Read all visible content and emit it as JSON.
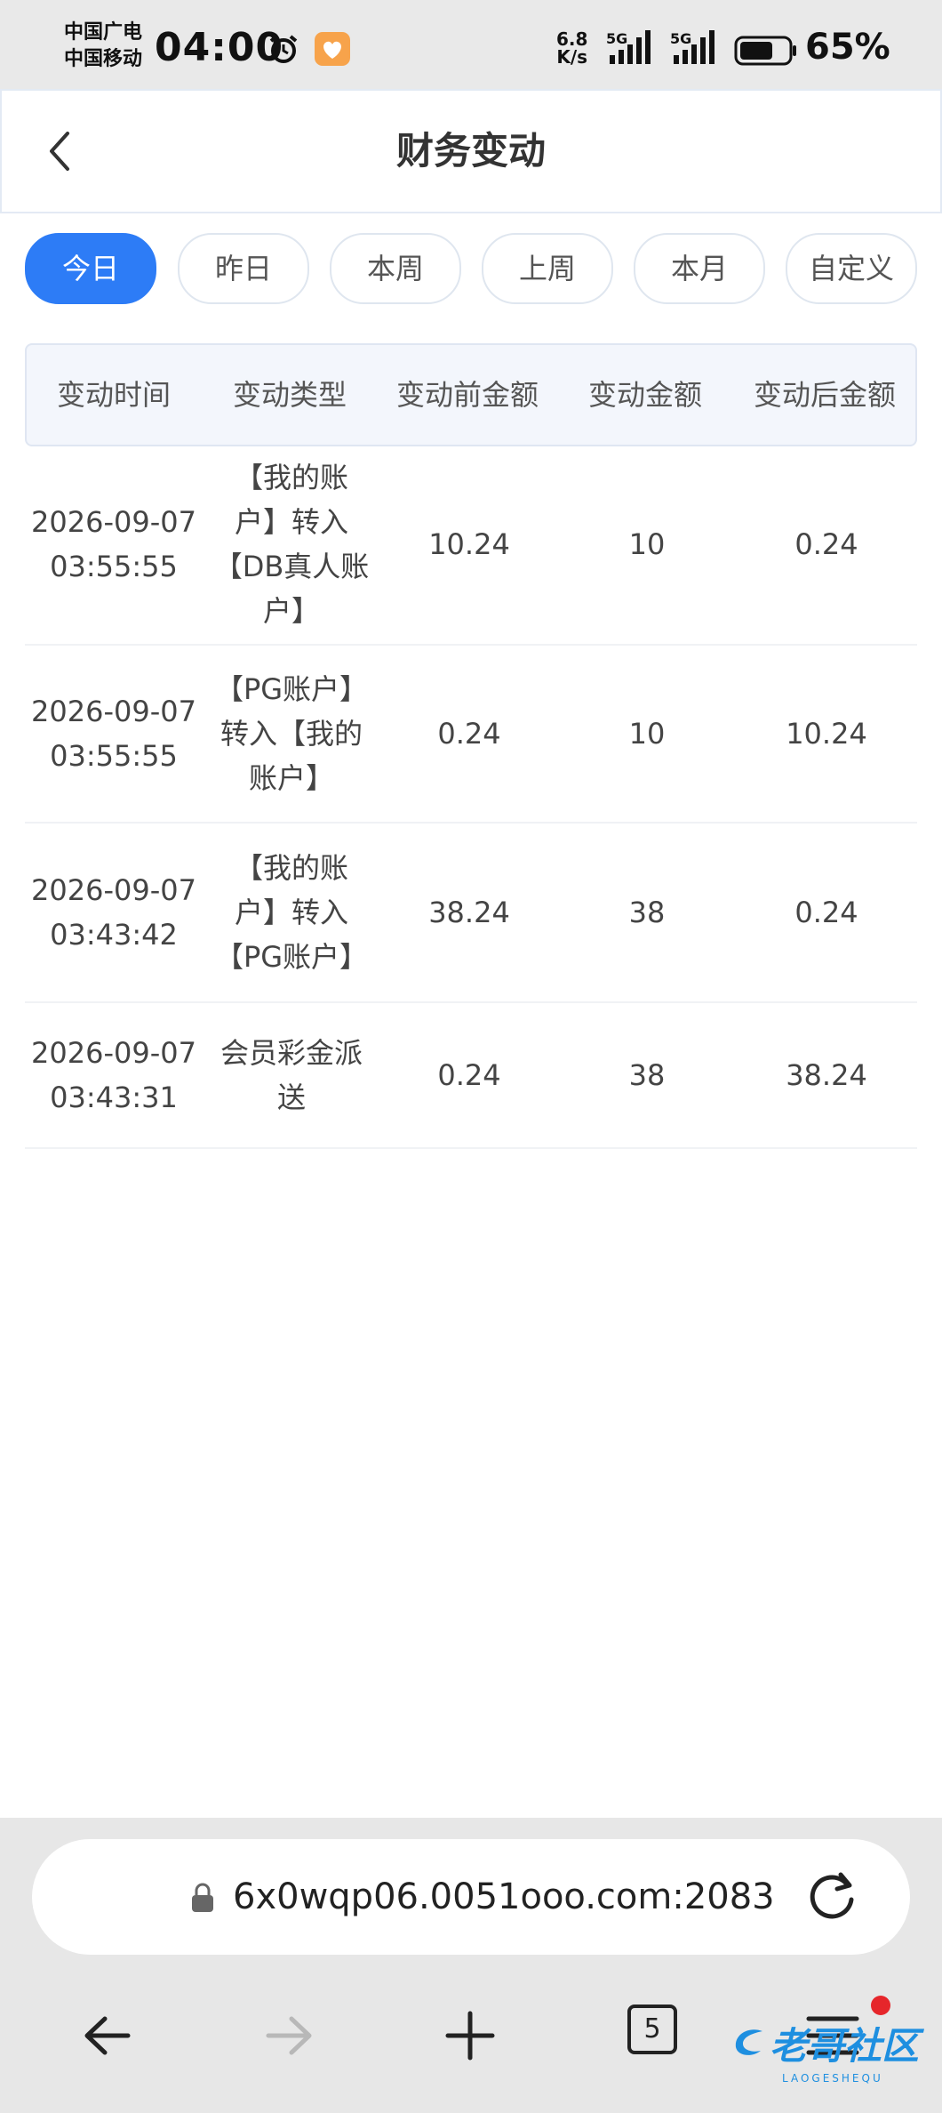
{
  "status_bar": {
    "carrier_1": "中国广电",
    "carrier_2": "中国移动",
    "time": "04:00",
    "net_speed_value": "6.8",
    "net_speed_unit": "K/s",
    "signal_1": "5G",
    "signal_2": "5G",
    "battery": "65%"
  },
  "header": {
    "title": "财务变动"
  },
  "filters": [
    {
      "label": "今日",
      "active": true
    },
    {
      "label": "昨日",
      "active": false
    },
    {
      "label": "本周",
      "active": false
    },
    {
      "label": "上周",
      "active": false
    },
    {
      "label": "本月",
      "active": false
    },
    {
      "label": "自定义",
      "active": false
    }
  ],
  "table": {
    "columns": [
      "变动时间",
      "变动类型",
      "变动前金额",
      "变动金额",
      "变动后金额"
    ],
    "rows": [
      {
        "date": "2026-09-07",
        "time": "03:55:55",
        "type_lines": [
          "【我的账",
          "户】转入",
          "【DB真人账",
          "户】"
        ],
        "before": "10.24",
        "amount": "10",
        "after": "0.24"
      },
      {
        "date": "2026-09-07",
        "time": "03:55:55",
        "type_lines": [
          "【PG账户】",
          "转入【我的",
          "账户】"
        ],
        "before": "0.24",
        "amount": "10",
        "after": "10.24"
      },
      {
        "date": "2026-09-07",
        "time": "03:43:42",
        "type_lines": [
          "【我的账",
          "户】转入",
          "【PG账户】"
        ],
        "before": "38.24",
        "amount": "38",
        "after": "0.24"
      },
      {
        "date": "2026-09-07",
        "time": "03:43:31",
        "type_lines": [
          "会员彩金派",
          "送"
        ],
        "before": "0.24",
        "amount": "38",
        "after": "38.24"
      }
    ]
  },
  "browser": {
    "url": "6x0wqp06.0051ooo.com:2083",
    "tab_count": "5"
  },
  "watermark": {
    "text": "老哥社区",
    "sub": "LAOGESHEQU"
  },
  "colors": {
    "accent": "#2d7cf6",
    "header_border": "#e3eaf4",
    "table_head_bg": "#f3f6fc",
    "notification_dot": "#e6262b"
  }
}
